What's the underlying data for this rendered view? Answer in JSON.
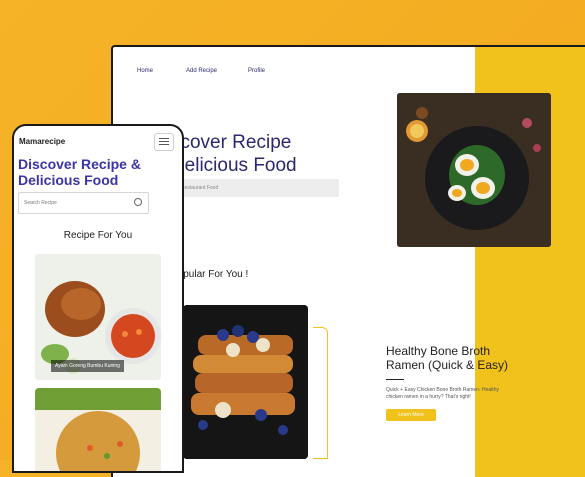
{
  "desktop": {
    "nav": {
      "home": "Home",
      "add_recipe": "Add Recipe",
      "profile": "Profile"
    },
    "hero": {
      "title_line1": "Discover Recipe",
      "title_line2": "& Delicious Food",
      "search_placeholder": "Restaurant Food"
    },
    "popular_title": "Popular For You !",
    "feature": {
      "title": "Healthy Bone Broth Ramen (Quick & Easy)",
      "desc": "Quick + Easy Chicken Bone Broth Ramen- Healthy chicken ramen in a hurry? That's right!",
      "button": "Learn More"
    }
  },
  "mobile": {
    "brand": "Mamarecipe",
    "title": "Discover Recipe & Delicious Food",
    "search_placeholder": "Search Recipe",
    "section_title": "Recipe For You",
    "cards": [
      {
        "label": "Ayam Goreng Bumbu Kuning"
      }
    ]
  },
  "colors": {
    "accent": "#f1c21b",
    "brand": "#3b35a8",
    "background": "#f5ad22"
  }
}
